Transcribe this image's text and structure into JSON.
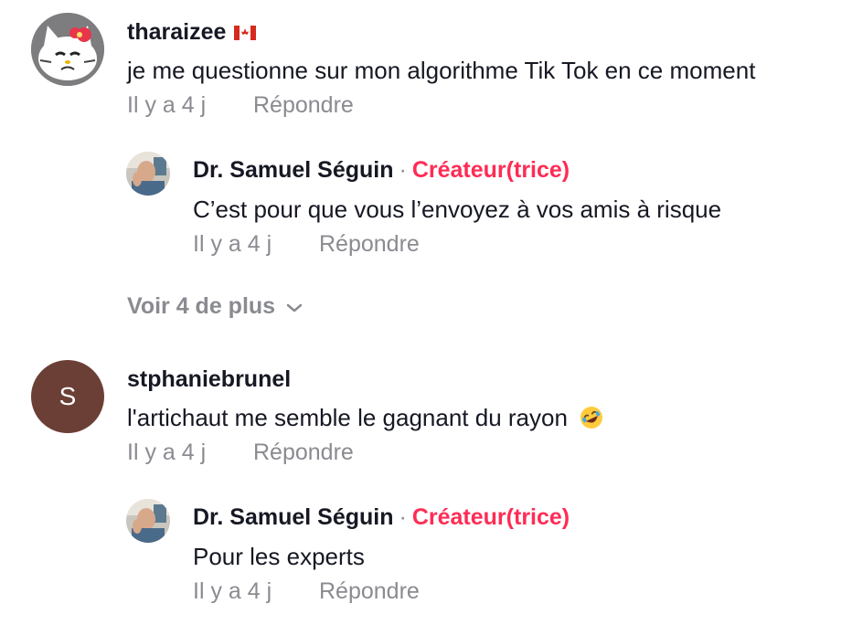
{
  "comments": [
    {
      "username": "tharaizee",
      "flag_icon": "canada-flag-icon",
      "text": "je me questionne sur mon algorithme Tik Tok en ce moment",
      "time": "Il y a 4 j",
      "reply_label": "Répondre",
      "avatar": "hello-kitty-grumpy-avatar",
      "replies": [
        {
          "username": "Dr. Samuel Séguin",
          "separator": "·",
          "badge": "Créateur(trice)",
          "badge_color": "#fe2c55",
          "text": "C’est pour que vous l’envoyez à vos amis à risque",
          "time": "Il y a 4 j",
          "reply_label": "Répondre"
        }
      ],
      "view_more": "Voir 4 de plus"
    },
    {
      "username": "stphaniebrunel",
      "avatar_letter": "S",
      "avatar_color": "#6b3f36",
      "text": "l'artichaut me semble le gagnant du rayon",
      "emoji": "rolling-laughing-emoji-icon",
      "time": "Il y a 4 j",
      "reply_label": "Répondre",
      "replies": [
        {
          "username": "Dr. Samuel Séguin",
          "separator": "·",
          "badge": "Créateur(trice)",
          "text": "Pour les experts",
          "time": "Il y a 4 j",
          "reply_label": "Répondre"
        }
      ]
    }
  ]
}
